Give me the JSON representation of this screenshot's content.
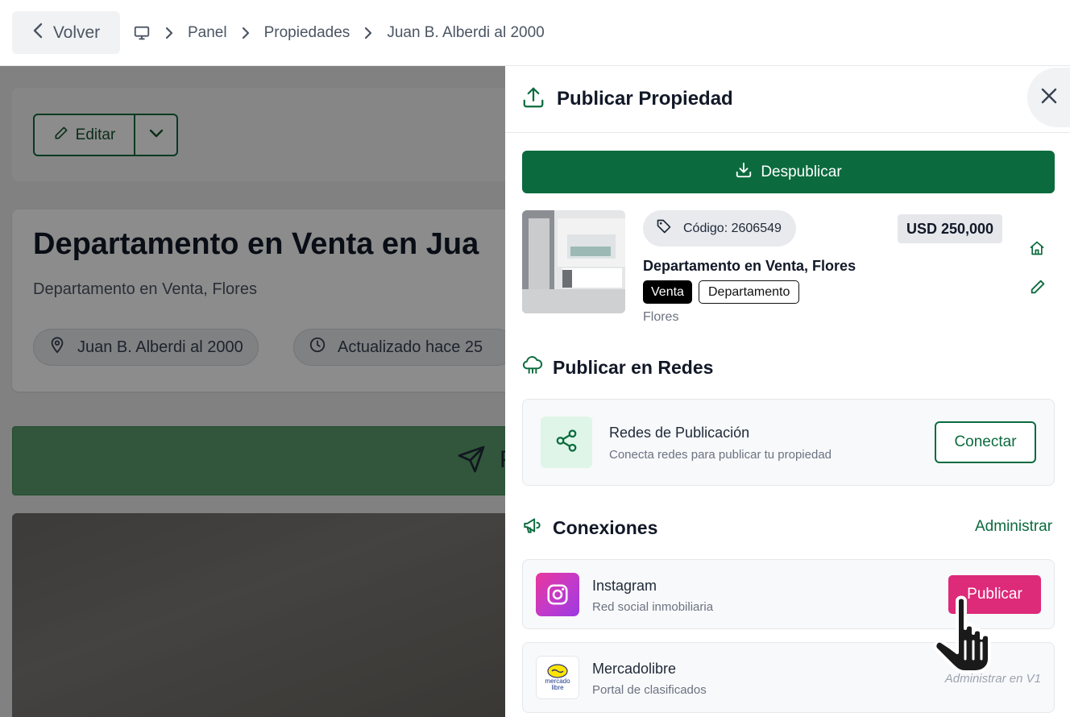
{
  "topbar": {
    "back_label": "Volver",
    "breadcrumbs": [
      "Panel",
      "Propiedades",
      "Juan B. Alberdi al 2000"
    ]
  },
  "background_page": {
    "edit_label": "Editar",
    "title": "Departamento en Venta en Jua",
    "subtitle": "Departamento en Venta, Flores",
    "address_chip": "Juan B. Alberdi al 2000",
    "updated_chip": "Actualizado hace 25",
    "green_button_letter": "P"
  },
  "panel": {
    "title": "Publicar Propiedad",
    "unpublish_label": "Despublicar",
    "property": {
      "code": "Código: 2606549",
      "price": "USD 250,000",
      "name": "Departamento en Venta, Flores",
      "operation_tag": "Venta",
      "type_tag": "Departamento",
      "location": "Flores"
    },
    "networks_section": {
      "title": "Publicar en Redes",
      "card_title": "Redes de Publicación",
      "card_subtitle": "Conecta redes para publicar tu propiedad",
      "connect_label": "Conectar"
    },
    "connections_section": {
      "title": "Conexiones",
      "manage_label": "Administrar",
      "items": [
        {
          "name": "Instagram",
          "subtitle": "Red social inmobiliaria",
          "action": "Publicar"
        },
        {
          "name": "Mercadolibre",
          "subtitle": "Portal de clasificados",
          "action": "Administrar en V1",
          "logo_text": "mercado libre"
        }
      ]
    }
  },
  "colors": {
    "brand_green": "#0b6b3e",
    "instagram_pink": "#dd2a79"
  }
}
